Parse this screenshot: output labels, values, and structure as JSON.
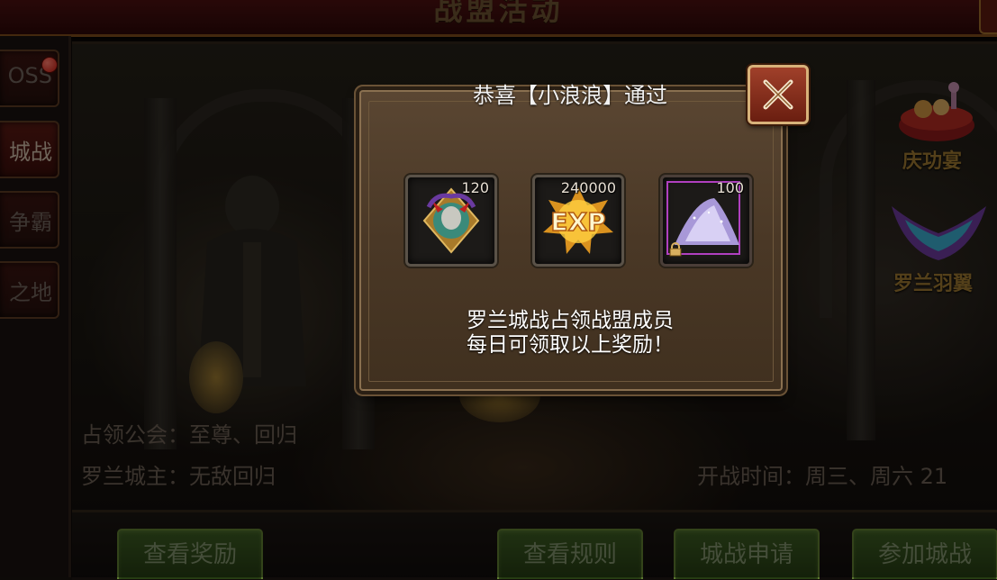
{
  "header": {
    "title": "战盟活动"
  },
  "sidebar": {
    "tabs": [
      {
        "label": "OSS",
        "active": false,
        "badge": true
      },
      {
        "label": "城战",
        "active": true
      },
      {
        "label": "争霸",
        "active": false
      },
      {
        "label": "之地",
        "active": false
      }
    ]
  },
  "info": {
    "occupying_guild": "占领公会：至尊、回归",
    "city_lord": "罗兰城主：无敌回归",
    "battle_time": "开战时间：周三、周六 21"
  },
  "side_features": [
    {
      "label": "庆功宴",
      "icon": "banquet-icon"
    },
    {
      "label": "罗兰羽翼",
      "icon": "wings-icon"
    }
  ],
  "buttons": {
    "view_rewards": "查看奖励",
    "view_rules": "查看规则",
    "apply_siege": "城战申请",
    "join_siege": "参加城战"
  },
  "popup": {
    "title": "恭喜【小浪浪】通过",
    "items": [
      {
        "icon": "medal-emblem-icon",
        "count": "120"
      },
      {
        "icon": "exp-icon",
        "count": "240000",
        "text": "EXP"
      },
      {
        "icon": "purple-powder-icon",
        "count": "100",
        "rarity": "#b040c0"
      }
    ],
    "message_line1": "罗兰城战占领战盟成员",
    "message_line2": "每日可领取以上奖励！"
  },
  "colors": {
    "accent_gold": "#9a7630",
    "button_green": "#3b5a22",
    "close_red": "#a0402a"
  }
}
